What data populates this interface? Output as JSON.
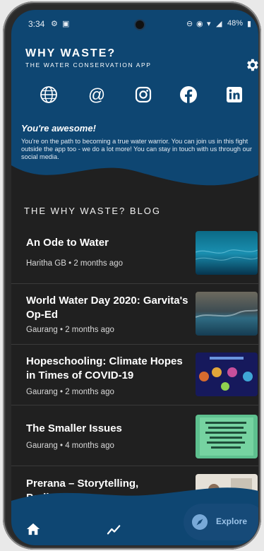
{
  "status_bar": {
    "time": "3:34",
    "battery": "48%"
  },
  "app": {
    "title": "WHY WASTE?",
    "subtitle": "THE WATER CONSERVATION APP"
  },
  "header": {
    "socials": [
      "website",
      "email",
      "instagram",
      "facebook",
      "linkedin"
    ],
    "headline": "You're awesome!",
    "message": "You're on the path to becoming a true water warrior. You can join us in this fight outside the app too - we do a lot more! You can stay in touch with us through our social media."
  },
  "blog": {
    "heading": "THE WHY WASTE? BLOG",
    "posts": [
      {
        "title": "An Ode to Water",
        "author": "Haritha GB",
        "age": "2 months ago"
      },
      {
        "title": "World Water Day 2020: Garvita's Op-Ed",
        "author": "Gaurang",
        "age": "2 months ago"
      },
      {
        "title": "Hopeschooling: Climate Hopes in Times of COVID-19",
        "author": "Gaurang",
        "age": "2 months ago"
      },
      {
        "title": "The Smaller Issues",
        "author": "Gaurang",
        "age": "4 months ago"
      },
      {
        "title": "Prerana – Storytelling, Parikrama",
        "author": "",
        "age": ""
      }
    ]
  },
  "nav": {
    "explore_label": "Explore"
  },
  "colors": {
    "header_blue": "#0e4672",
    "nav_blue": "#0e4672",
    "explore_pill": "#164a78",
    "background": "#202020"
  }
}
